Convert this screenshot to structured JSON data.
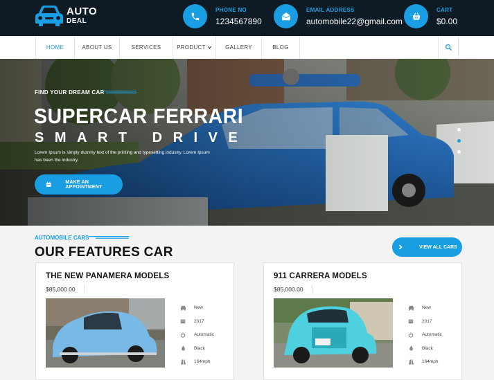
{
  "brand": {
    "line1": "AUTO",
    "line2": "DEAL"
  },
  "contacts": [
    {
      "icon": "phone-icon",
      "label": "PHONE NO",
      "value": "1234567890"
    },
    {
      "icon": "envelope-icon",
      "label": "EMAIL ADDRESS",
      "value": "automobile22@gmail.com"
    },
    {
      "icon": "basket-icon",
      "label": "CART",
      "value": "$0.00"
    }
  ],
  "nav": {
    "items": [
      {
        "label": "HOME",
        "active": true
      },
      {
        "label": "ABOUT US"
      },
      {
        "label": "SERVICES"
      },
      {
        "label": "PRODUCT"
      },
      {
        "label": "GALLERY"
      },
      {
        "label": "BLOG"
      }
    ],
    "search_icon": "search-icon"
  },
  "hero": {
    "kicker": "FIND YOUR DREAM CAR",
    "title": "SUPERCAR FERRARI",
    "subtitle": "SMART DRIVE",
    "description": "Lorem Ipsum is simply dummy text of the printing and typesetting industry. Lorem Ipsum has been the industry.",
    "cta": "MAKE AN APPOINTMENT",
    "slides": 3,
    "active_slide": 2
  },
  "features": {
    "kicker": "AUTOMOBILE CARS",
    "title": "OUR FEATURES CAR",
    "view_all": "VIEW ALL CARS"
  },
  "cars": [
    {
      "title": "THE NEW PANAMERA MODELS",
      "price": "$85,000.00",
      "specs": [
        {
          "icon": "car-icon",
          "value": "New"
        },
        {
          "icon": "calendar-icon",
          "value": "2017"
        },
        {
          "icon": "power-icon",
          "value": "Automatic"
        },
        {
          "icon": "drop-icon",
          "value": "Black"
        },
        {
          "icon": "road-icon",
          "value": "164mph"
        }
      ]
    },
    {
      "title": "911 CARRERA MODELS",
      "price": "$85,000.00",
      "specs": [
        {
          "icon": "car-icon",
          "value": "New"
        },
        {
          "icon": "calendar-icon",
          "value": "2017"
        },
        {
          "icon": "power-icon",
          "value": "Automatic"
        },
        {
          "icon": "drop-icon",
          "value": "Black"
        },
        {
          "icon": "road-icon",
          "value": "164mph"
        }
      ]
    }
  ],
  "colors": {
    "accent": "#1a9ee3",
    "topbar": "#0e1b24"
  }
}
